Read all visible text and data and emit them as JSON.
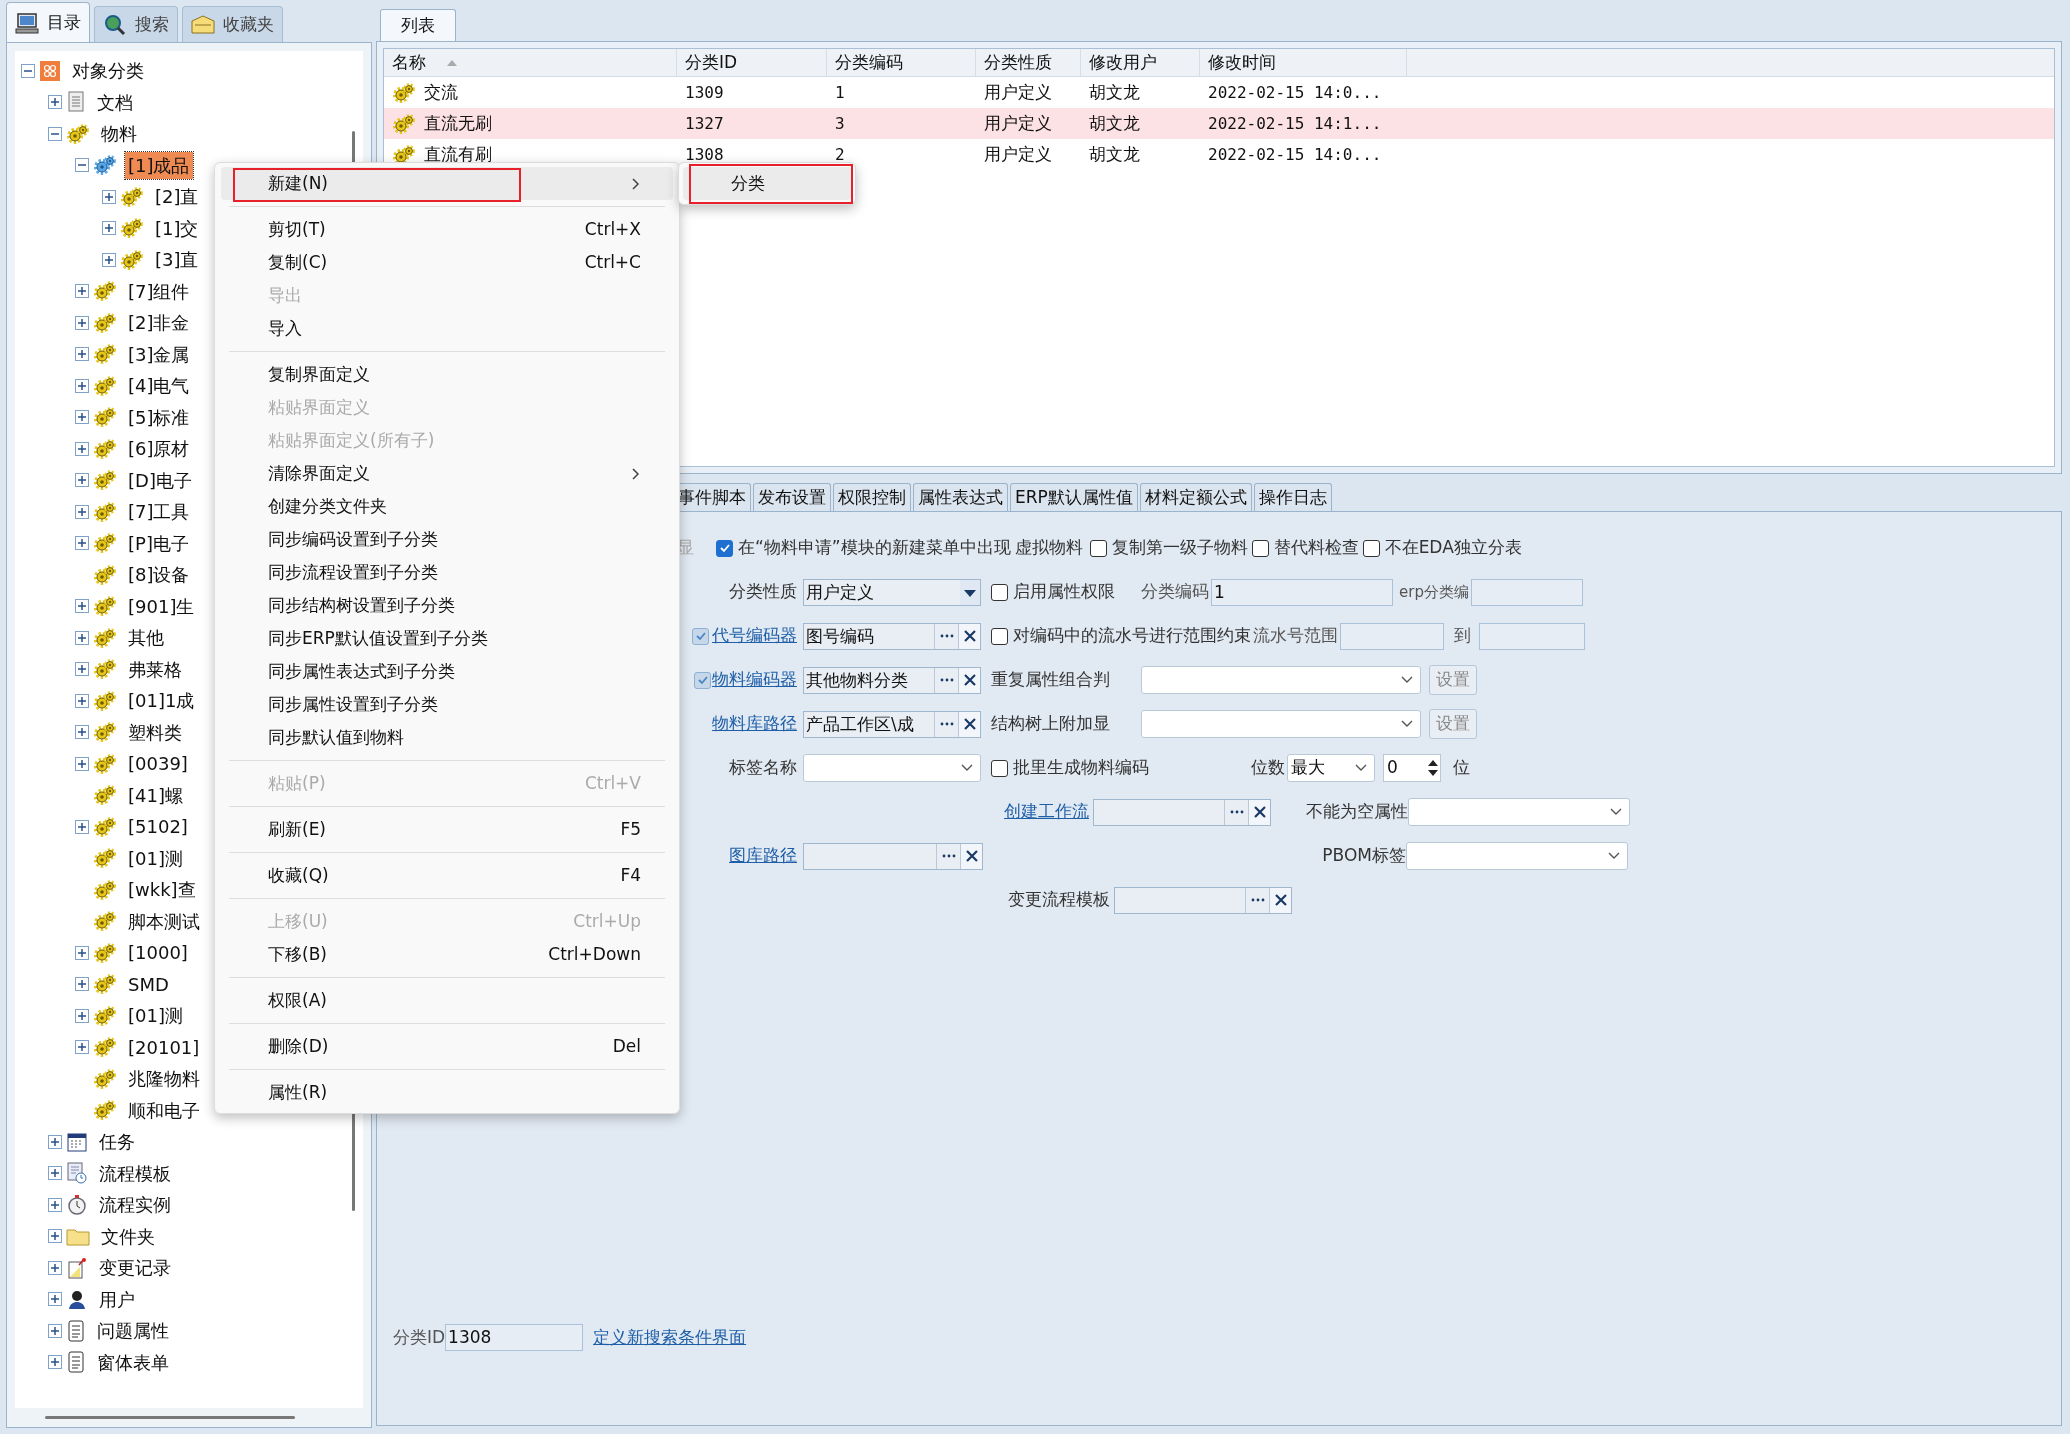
{
  "nav_tabs": [
    {
      "kind": "computer",
      "label": "目录",
      "selected": true
    },
    {
      "kind": "search",
      "label": "搜索",
      "selected": false
    },
    {
      "kind": "favorites",
      "label": "收藏夹",
      "selected": false
    }
  ],
  "tree": [
    {
      "kind": "root",
      "label": "对象分类",
      "expandable": true,
      "expanded": true,
      "selected": false,
      "children": [
        {
          "kind": "document",
          "label": "文档",
          "expandable": true,
          "expanded": false,
          "selected": false
        },
        {
          "kind": "gear",
          "label": "物料",
          "expandable": true,
          "expanded": true,
          "selected": false,
          "children": [
            {
              "kind": "gear-blue",
              "label": "[1]成品",
              "expandable": true,
              "expanded": true,
              "selected": true,
              "children": [
                {
                  "kind": "gear",
                  "label": "[2]直",
                  "expandable": true,
                  "expanded": false,
                  "selected": false
                },
                {
                  "kind": "gear",
                  "label": "[1]交",
                  "expandable": true,
                  "expanded": false,
                  "selected": false
                },
                {
                  "kind": "gear",
                  "label": "[3]直",
                  "expandable": true,
                  "expanded": false,
                  "selected": false
                }
              ]
            },
            {
              "kind": "gear",
              "label": "[7]组件",
              "expandable": true,
              "expanded": false,
              "selected": false
            },
            {
              "kind": "gear",
              "label": "[2]非金",
              "expandable": true,
              "expanded": false,
              "selected": false
            },
            {
              "kind": "gear",
              "label": "[3]金属",
              "expandable": true,
              "expanded": false,
              "selected": false
            },
            {
              "kind": "gear",
              "label": "[4]电气",
              "expandable": true,
              "expanded": false,
              "selected": false
            },
            {
              "kind": "gear",
              "label": "[5]标准",
              "expandable": true,
              "expanded": false,
              "selected": false
            },
            {
              "kind": "gear",
              "label": "[6]原材",
              "expandable": true,
              "expanded": false,
              "selected": false
            },
            {
              "kind": "gear",
              "label": "[D]电子",
              "expandable": true,
              "expanded": false,
              "selected": false
            },
            {
              "kind": "gear",
              "label": "[7]工具",
              "expandable": true,
              "expanded": false,
              "selected": false
            },
            {
              "kind": "gear",
              "label": "[P]电子",
              "expandable": true,
              "expanded": false,
              "selected": false
            },
            {
              "kind": "gear",
              "label": "[8]设备",
              "expandable": false,
              "selected": false
            },
            {
              "kind": "gear",
              "label": "[901]生",
              "expandable": true,
              "expanded": false,
              "selected": false
            },
            {
              "kind": "gear",
              "label": "其他",
              "expandable": true,
              "expanded": false,
              "selected": false
            },
            {
              "kind": "gear",
              "label": "弗莱格",
              "expandable": true,
              "expanded": false,
              "selected": false
            },
            {
              "kind": "gear",
              "label": "[01]1成",
              "expandable": true,
              "expanded": false,
              "selected": false
            },
            {
              "kind": "gear",
              "label": "塑料类",
              "expandable": true,
              "expanded": false,
              "selected": false
            },
            {
              "kind": "gear",
              "label": "[0039]",
              "expandable": true,
              "expanded": false,
              "selected": false
            },
            {
              "kind": "gear",
              "label": "[41]螺",
              "expandable": false,
              "selected": false
            },
            {
              "kind": "gear",
              "label": "[5102]",
              "expandable": true,
              "expanded": false,
              "selected": false
            },
            {
              "kind": "gear",
              "label": "[01]测",
              "expandable": false,
              "selected": false
            },
            {
              "kind": "gear",
              "label": "[wkk]查",
              "expandable": false,
              "selected": false
            },
            {
              "kind": "gear",
              "label": "脚本测试",
              "expandable": false,
              "selected": false
            },
            {
              "kind": "gear",
              "label": "[1000]",
              "expandable": true,
              "expanded": false,
              "selected": false
            },
            {
              "kind": "gear",
              "label": "SMD",
              "expandable": true,
              "expanded": false,
              "selected": false
            },
            {
              "kind": "gear",
              "label": "[01]测",
              "expandable": true,
              "expanded": false,
              "selected": false
            },
            {
              "kind": "gear",
              "label": "[20101]",
              "expandable": true,
              "expanded": false,
              "selected": false
            },
            {
              "kind": "gear",
              "label": "兆隆物料",
              "expandable": false,
              "selected": false
            },
            {
              "kind": "gear",
              "label": "顺和电子",
              "expandable": false,
              "selected": false
            }
          ]
        },
        {
          "kind": "calendar",
          "label": "任务",
          "expandable": true,
          "expanded": false,
          "selected": false
        },
        {
          "kind": "template",
          "label": "流程模板",
          "expandable": true,
          "expanded": false,
          "selected": false
        },
        {
          "kind": "clock",
          "label": "流程实例",
          "expandable": true,
          "expanded": false,
          "selected": false
        },
        {
          "kind": "folder",
          "label": "文件夹",
          "expandable": true,
          "expanded": false,
          "selected": false
        },
        {
          "kind": "note",
          "label": "变更记录",
          "expandable": true,
          "expanded": false,
          "selected": false
        },
        {
          "kind": "user",
          "label": "用户",
          "expandable": true,
          "expanded": false,
          "selected": false
        },
        {
          "kind": "form",
          "label": "问题属性",
          "expandable": true,
          "expanded": false,
          "selected": false
        },
        {
          "kind": "form",
          "label": "窗体表单",
          "expandable": true,
          "expanded": false,
          "selected": false
        }
      ]
    }
  ],
  "list_tab": {
    "label": "列表",
    "selected": true
  },
  "table": {
    "columns": [
      "名称",
      "分类ID",
      "分类编码",
      "分类性质",
      "修改用户",
      "修改时间"
    ],
    "rows": [
      {
        "selected": false,
        "cells": [
          "交流",
          "1309",
          "1",
          "用户定义",
          "胡文龙",
          "2022-02-15 14:0..."
        ]
      },
      {
        "selected": true,
        "cells": [
          "直流无刷",
          "1327",
          "3",
          "用户定义",
          "胡文龙",
          "2022-02-15 14:1..."
        ]
      },
      {
        "selected": false,
        "cells": [
          "直流有刷",
          "1308",
          "2",
          "用户定义",
          "胡文龙",
          "2022-02-15 14:0..."
        ]
      }
    ]
  },
  "detail_tabs": [
    {
      "label": "事件脚本",
      "selected": false
    },
    {
      "label": "发布设置",
      "selected": false
    },
    {
      "label": "权限控制",
      "selected": false
    },
    {
      "label": "属性表达式",
      "selected": false
    },
    {
      "label": "ERP默认属性值",
      "selected": false
    },
    {
      "label": "材料定额公式",
      "selected": false
    },
    {
      "label": "操作日志",
      "selected": false
    }
  ],
  "form": {
    "prefix": "显",
    "options": [
      {
        "kind": "checkbox",
        "label": "在“物料申请”模块的新建菜单中出现",
        "checked": true
      },
      {
        "kind": "text",
        "label": "虚拟物料"
      },
      {
        "kind": "checkbox",
        "label": "复制第一级子物料",
        "checked": false
      },
      {
        "kind": "checkbox",
        "label": "替代料检查",
        "checked": false
      },
      {
        "kind": "checkbox",
        "label": "不在EDA独立分表",
        "checked": false
      }
    ],
    "category_type": {
      "label": "分类性质",
      "value": "用户定义"
    },
    "attr_permission": {
      "label": "启用属性权限",
      "checked": false
    },
    "category_code": {
      "label": "分类编码",
      "value": "1"
    },
    "erp_code": {
      "label": "erp分类编"
    },
    "code_encoder": {
      "label": "代号编码器",
      "checked": true,
      "value": "图号编码"
    },
    "serial_limit": {
      "label": "对编码中的流水号进行范围约束",
      "checked": false
    },
    "serial_range": {
      "label": "流水号范围",
      "to_label": "到"
    },
    "material_encoder": {
      "label": "物料编码器",
      "checked": true,
      "value": "其他物料分类"
    },
    "duplicate_check": {
      "label": "重复属性组合判",
      "button": "设置"
    },
    "library_path": {
      "label": "物料库路径",
      "value": "产品工作区\\成"
    },
    "tree_display": {
      "label": "结构树上附加显",
      "button": "设置"
    },
    "tag_name": {
      "label": "标签名称"
    },
    "batch_code": {
      "label": "批里生成物料编码",
      "checked": false
    },
    "digits": {
      "label": "位数",
      "value": "最大",
      "count": "0",
      "unit": "位"
    },
    "workflow": {
      "label": "创建工作流"
    },
    "required_attr": {
      "label": "不能为空属性"
    },
    "drawing_path": {
      "label": "图库路径"
    },
    "pbom_tag": {
      "label": "PBOM标签"
    },
    "change_template": {
      "label": "变更流程模板"
    },
    "category_id": {
      "label": "分类ID",
      "value": "1308"
    },
    "search_link": "定义新搜索条件界面"
  },
  "context_menu": [
    {
      "kind": "submenu",
      "label": "新建(N)",
      "disabled": false,
      "highlighted": true
    },
    {
      "kind": "separator"
    },
    {
      "kind": "item",
      "label": "剪切(T)",
      "shortcut": "Ctrl+X",
      "disabled": false,
      "highlighted": false
    },
    {
      "kind": "item",
      "label": "复制(C)",
      "shortcut": "Ctrl+C",
      "disabled": false,
      "highlighted": false
    },
    {
      "kind": "item",
      "label": "导出",
      "disabled": true,
      "highlighted": false
    },
    {
      "kind": "item",
      "label": "导入",
      "disabled": false,
      "highlighted": false
    },
    {
      "kind": "separator"
    },
    {
      "kind": "item",
      "label": "复制界面定义",
      "disabled": false,
      "highlighted": false
    },
    {
      "kind": "item",
      "label": "粘贴界面定义",
      "disabled": true,
      "highlighted": false
    },
    {
      "kind": "item",
      "label": "粘贴界面定义(所有子)",
      "disabled": true,
      "highlighted": false
    },
    {
      "kind": "submenu",
      "label": "清除界面定义",
      "disabled": false,
      "highlighted": false
    },
    {
      "kind": "item",
      "label": "创建分类文件夹",
      "disabled": false,
      "highlighted": false
    },
    {
      "kind": "item",
      "label": "同步编码设置到子分类",
      "disabled": false,
      "highlighted": false
    },
    {
      "kind": "item",
      "label": "同步流程设置到子分类",
      "disabled": false,
      "highlighted": false
    },
    {
      "kind": "item",
      "label": "同步结构树设置到子分类",
      "disabled": false,
      "highlighted": false
    },
    {
      "kind": "item",
      "label": "同步ERP默认值设置到子分类",
      "disabled": false,
      "highlighted": false
    },
    {
      "kind": "item",
      "label": "同步属性表达式到子分类",
      "disabled": false,
      "highlighted": false
    },
    {
      "kind": "item",
      "label": "同步属性设置到子分类",
      "disabled": false,
      "highlighted": false
    },
    {
      "kind": "item",
      "label": "同步默认值到物料",
      "disabled": false,
      "highlighted": false
    },
    {
      "kind": "separator"
    },
    {
      "kind": "item",
      "label": "粘贴(P)",
      "shortcut": "Ctrl+V",
      "disabled": true,
      "highlighted": false
    },
    {
      "kind": "separator"
    },
    {
      "kind": "item",
      "label": "刷新(E)",
      "shortcut": "F5",
      "disabled": false,
      "highlighted": false
    },
    {
      "kind": "separator"
    },
    {
      "kind": "item",
      "label": "收藏(Q)",
      "shortcut": "F4",
      "disabled": false,
      "highlighted": false
    },
    {
      "kind": "separator"
    },
    {
      "kind": "item",
      "label": "上移(U)",
      "shortcut": "Ctrl+Up",
      "disabled": true,
      "highlighted": false
    },
    {
      "kind": "item",
      "label": "下移(B)",
      "shortcut": "Ctrl+Down",
      "disabled": false,
      "highlighted": false
    },
    {
      "kind": "separator"
    },
    {
      "kind": "item",
      "label": "权限(A)",
      "disabled": false,
      "highlighted": false
    },
    {
      "kind": "separator"
    },
    {
      "kind": "item",
      "label": "删除(D)",
      "shortcut": "Del",
      "disabled": false,
      "highlighted": false
    },
    {
      "kind": "separator"
    },
    {
      "kind": "item",
      "label": "属性(R)",
      "disabled": false,
      "highlighted": false
    }
  ],
  "submenu": [
    {
      "label": "分类",
      "highlighted": true
    }
  ]
}
